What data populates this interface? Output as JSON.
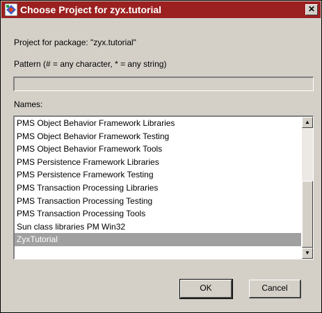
{
  "dialog": {
    "title": "Choose Project for zyx.tutorial",
    "close_glyph": "✕"
  },
  "labels": {
    "project": "Project for package: \"zyx.tutorial\"",
    "pattern": "Pattern (# = any character, * = any string)",
    "names": "Names:"
  },
  "pattern_field": {
    "value": "",
    "placeholder": ""
  },
  "names_list": {
    "items": [
      "PMS Object Behavior Framework Libraries",
      "PMS Object Behavior Framework Testing",
      "PMS Object Behavior Framework Tools",
      "PMS Persistence Framework Libraries",
      "PMS Persistence Framework Testing",
      "PMS Transaction Processing Libraries",
      "PMS Transaction Processing Testing",
      "PMS Transaction Processing Tools",
      "Sun class libraries PM Win32",
      "ZyxTutorial"
    ],
    "selected_index": 9
  },
  "scrollbar": {
    "up_glyph": "▲",
    "down_glyph": "▼"
  },
  "buttons": {
    "ok": "OK",
    "cancel": "Cancel"
  },
  "colors": {
    "titlebar": "#9b2020",
    "selection": "#a0a0a0",
    "face": "#d4d0c8"
  }
}
